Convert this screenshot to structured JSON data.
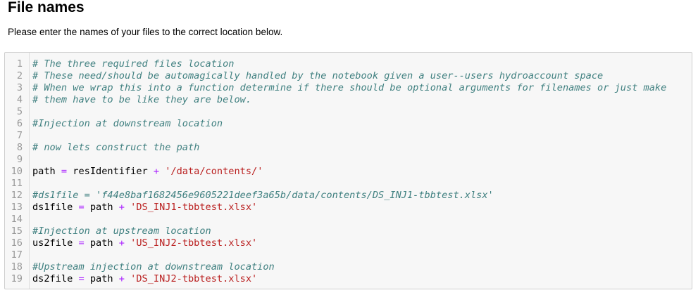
{
  "section": {
    "title": "File names",
    "description": "Please enter the names of your files to the correct location below."
  },
  "code_cell": {
    "lines": [
      {
        "n": "1",
        "tokens": [
          {
            "t": "comment",
            "v": "# The three required files location"
          }
        ]
      },
      {
        "n": "2",
        "tokens": [
          {
            "t": "comment",
            "v": "# These need/should be automagically handled by the notebook given a user--users hydroaccount space"
          }
        ]
      },
      {
        "n": "3",
        "tokens": [
          {
            "t": "comment",
            "v": "# When we wrap this into a function determine if there should be optional arguments for filenames or just make"
          }
        ]
      },
      {
        "n": "4",
        "tokens": [
          {
            "t": "comment",
            "v": "# them have to be like they are below."
          }
        ]
      },
      {
        "n": "5",
        "tokens": []
      },
      {
        "n": "6",
        "tokens": [
          {
            "t": "comment",
            "v": "#Injection at downstream location"
          }
        ]
      },
      {
        "n": "7",
        "tokens": []
      },
      {
        "n": "8",
        "tokens": [
          {
            "t": "comment",
            "v": "# now lets construct the path"
          }
        ]
      },
      {
        "n": "9",
        "tokens": []
      },
      {
        "n": "10",
        "tokens": [
          {
            "t": "var",
            "v": "path "
          },
          {
            "t": "op",
            "v": "="
          },
          {
            "t": "var",
            "v": " resIdentifier "
          },
          {
            "t": "op",
            "v": "+"
          },
          {
            "t": "var",
            "v": " "
          },
          {
            "t": "str",
            "v": "'/data/contents/'"
          }
        ]
      },
      {
        "n": "11",
        "tokens": []
      },
      {
        "n": "12",
        "tokens": [
          {
            "t": "comment",
            "v": "#ds1file = 'f44e8baf1682456e9605221deef3a65b/data/contents/DS_INJ1-tbbtest.xlsx'"
          }
        ]
      },
      {
        "n": "13",
        "tokens": [
          {
            "t": "var",
            "v": "ds1file "
          },
          {
            "t": "op",
            "v": "="
          },
          {
            "t": "var",
            "v": " path "
          },
          {
            "t": "op",
            "v": "+"
          },
          {
            "t": "var",
            "v": " "
          },
          {
            "t": "str",
            "v": "'DS_INJ1-tbbtest.xlsx'"
          }
        ]
      },
      {
        "n": "14",
        "tokens": []
      },
      {
        "n": "15",
        "tokens": [
          {
            "t": "comment",
            "v": "#Injection at upstream location"
          }
        ]
      },
      {
        "n": "16",
        "tokens": [
          {
            "t": "var",
            "v": "us2file "
          },
          {
            "t": "op",
            "v": "="
          },
          {
            "t": "var",
            "v": " path "
          },
          {
            "t": "op",
            "v": "+"
          },
          {
            "t": "var",
            "v": " "
          },
          {
            "t": "str",
            "v": "'US_INJ2-tbbtest.xlsx'"
          }
        ]
      },
      {
        "n": "17",
        "tokens": []
      },
      {
        "n": "18",
        "tokens": [
          {
            "t": "comment",
            "v": "#Upstream injection at downstream location"
          }
        ]
      },
      {
        "n": "19",
        "tokens": [
          {
            "t": "var",
            "v": "ds2file "
          },
          {
            "t": "op",
            "v": "="
          },
          {
            "t": "var",
            "v": " path "
          },
          {
            "t": "op",
            "v": "+"
          },
          {
            "t": "var",
            "v": " "
          },
          {
            "t": "str",
            "v": "'DS_INJ2-tbbtest.xlsx'"
          }
        ]
      }
    ]
  },
  "colors": {
    "comment": "#408080",
    "operator": "#aa22ff",
    "string": "#ba2121",
    "line_number": "#999999",
    "cell_background": "#f7f7f7",
    "cell_border": "#cfcfcf"
  }
}
